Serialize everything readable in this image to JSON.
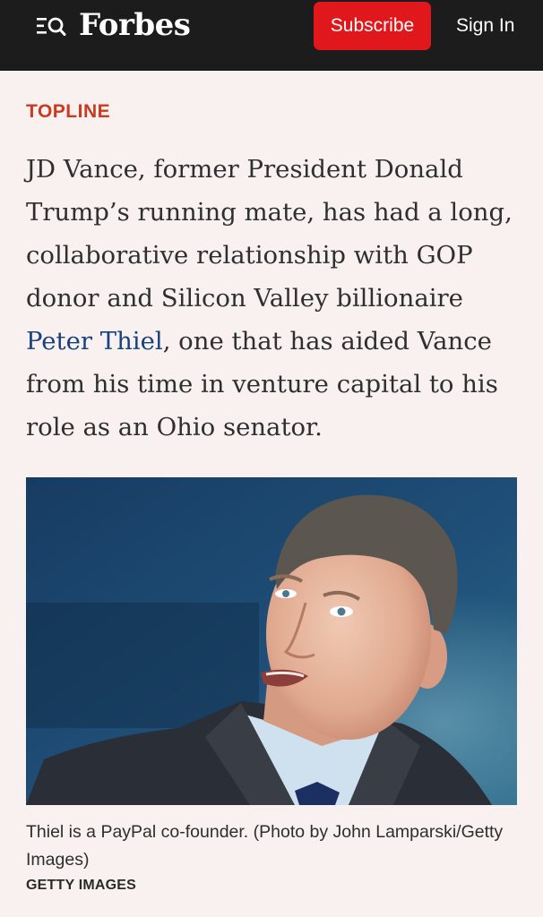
{
  "header": {
    "logo": "Forbes",
    "menu_icon": "menu-search-icon",
    "subscribe_label": "Subscribe",
    "signin_label": "Sign In",
    "background_color": "#1c1c1c",
    "subscribe_color": "#e0181b"
  },
  "article": {
    "section_label": "TOPLINE",
    "section_color": "#c93a21",
    "topline": {
      "before_link": "JD Vance, former President Donald Trump’s running mate, has had a long, collaborative relationship with GOP donor and Silicon Valley billionaire ",
      "link_text": "Peter Thiel",
      "after_link": ", one that has aided Vance from his time in venture capital to his role as an Ohio senator.",
      "link_color": "#18417f"
    },
    "image": {
      "caption": "Thiel is a PayPal co-founder. (Photo by John Lamparski/Getty Images)",
      "credit": "GETTY IMAGES"
    }
  }
}
